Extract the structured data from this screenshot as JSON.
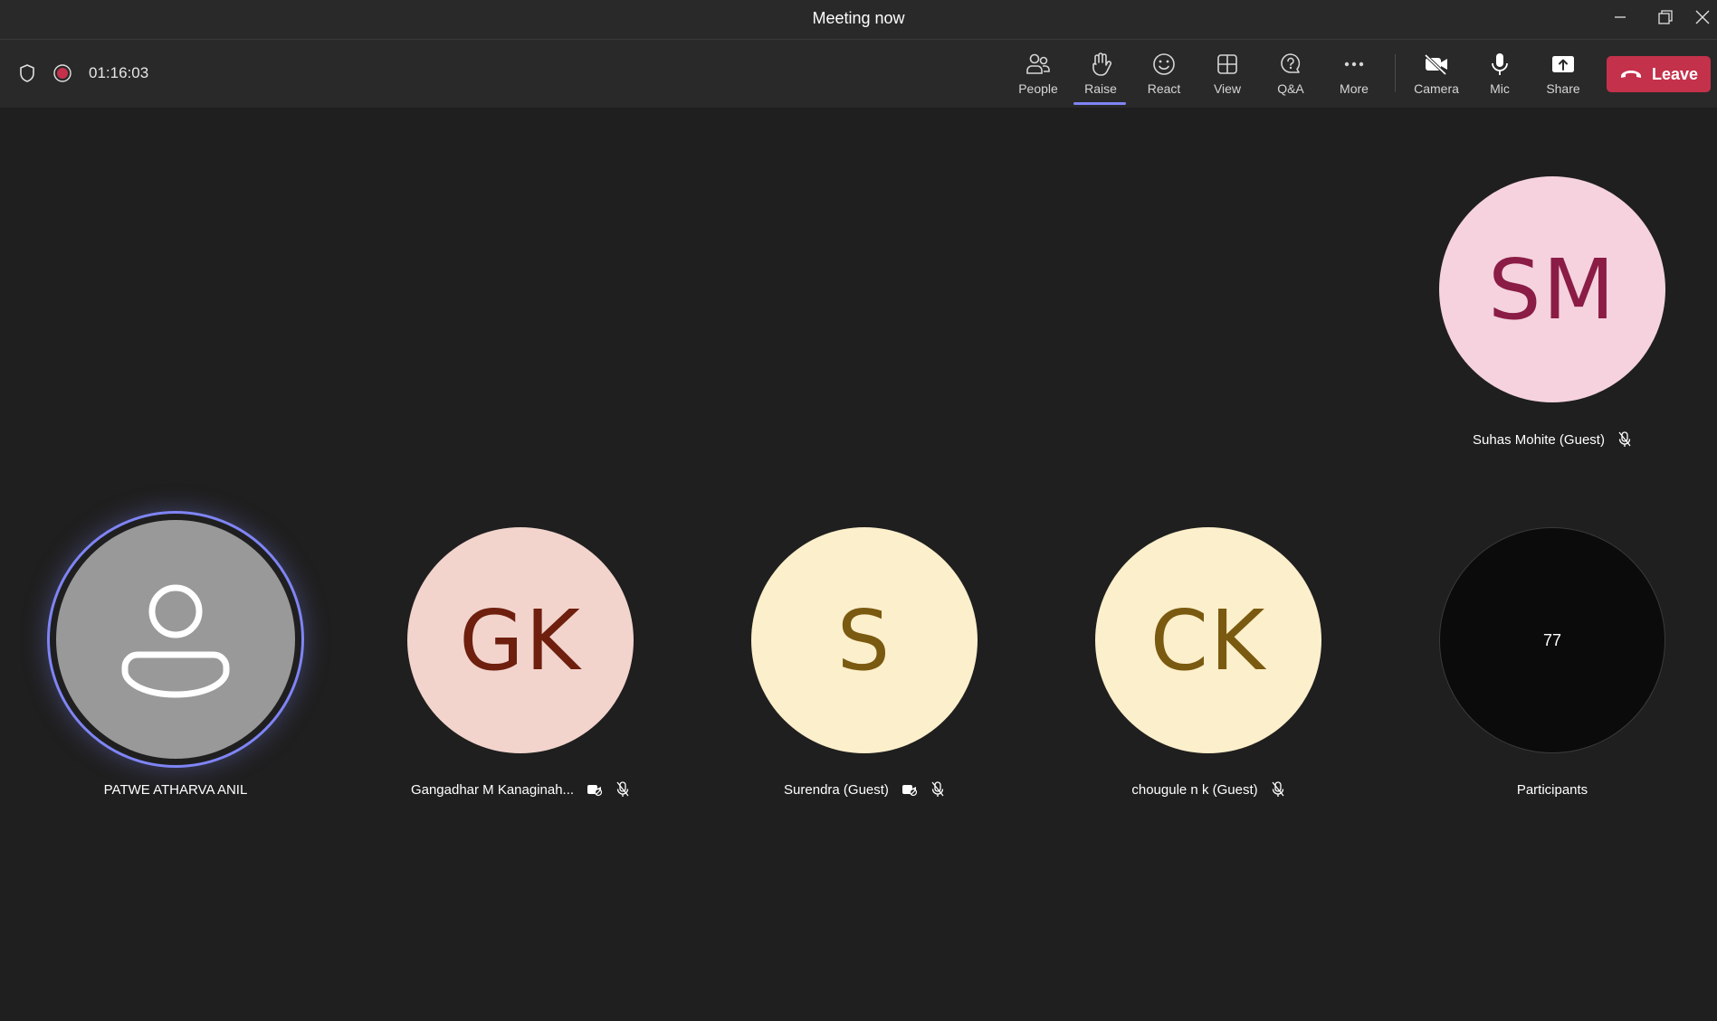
{
  "window": {
    "title": "Meeting now"
  },
  "toolbar": {
    "timer": "01:16:03",
    "buttons": {
      "people": "People",
      "raise": "Raise",
      "react": "React",
      "view": "View",
      "qa": "Q&A",
      "more": "More",
      "camera": "Camera",
      "mic": "Mic",
      "share": "Share"
    },
    "leave": "Leave"
  },
  "participants": [
    {
      "initials": "SM",
      "name": "Suhas Mohite (Guest)",
      "bg": "#f5d2de",
      "fg": "#8a1c45",
      "muted": true
    },
    {
      "initials": "",
      "name": "PATWE ATHARVA ANIL",
      "bg": "#999999",
      "fg": "#ffffff",
      "speaking": true,
      "icon": "person-icon"
    },
    {
      "initials": "GK",
      "name": "Gangadhar M Kanaginah...",
      "bg": "#f2d4cd",
      "fg": "#6e1f0e",
      "muted": true,
      "camera_off": true
    },
    {
      "initials": "S",
      "name": "Surendra (Guest)",
      "bg": "#fcefcb",
      "fg": "#7a5a10",
      "muted": true,
      "camera_off": true
    },
    {
      "initials": "CK",
      "name": "chougule n k (Guest)",
      "bg": "#fcefcb",
      "fg": "#7a5a10",
      "muted": true
    }
  ],
  "overflow": {
    "count": "77",
    "label": "Participants"
  },
  "colors": {
    "accent": "#7f85f5",
    "leave": "#c4314b",
    "record": "#c4314b"
  }
}
